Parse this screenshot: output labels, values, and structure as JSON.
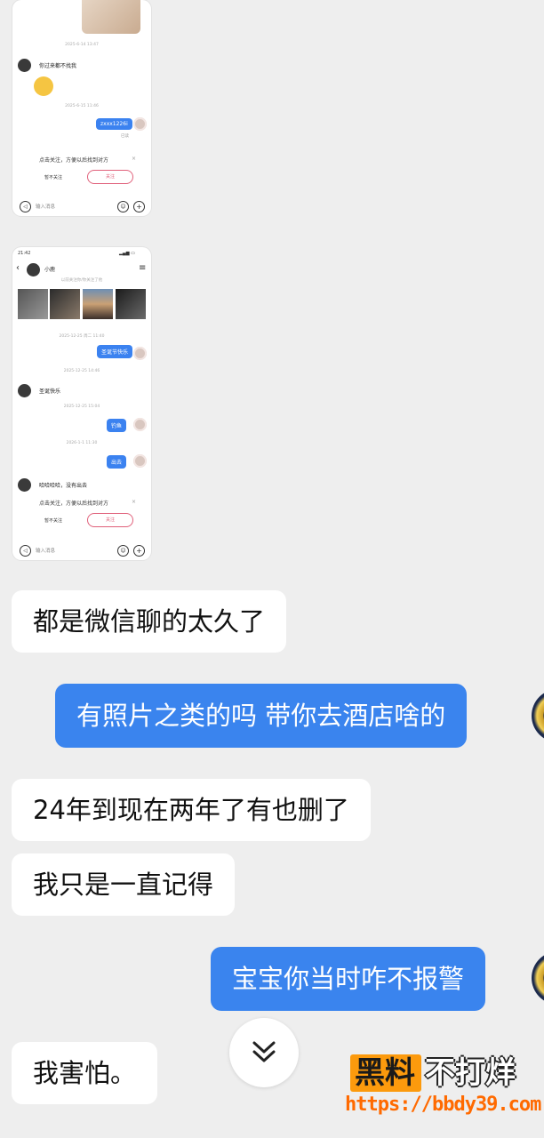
{
  "thumb1": {
    "timestamp_top": "2025-6-14 13:47",
    "msg_in_1": "你过来都不找我",
    "timestamp_2": "2025-6-15 11:46",
    "msg_out_1": "zxxx1226i",
    "read_mark": "已读",
    "follow_prompt": "点击关注，方便以后找到对方",
    "dismiss": "暂不关注",
    "follow_btn": "关注",
    "input_placeholder": "输入消息",
    "close_glyph": "×"
  },
  "thumb2": {
    "status_time": "21:42",
    "contact_name": "小鹿",
    "subtitle": "以前关注你/你关注了他",
    "ts_1": "2025-12-25 周二 11:40",
    "msg_out_1": "圣诞节快乐",
    "ts_2": "2025-12-25 14:46",
    "msg_in_1": "圣诞快乐",
    "ts_3": "2025-12-25 15:04",
    "msg_out_2": "钓鱼",
    "ts_4": "2026-1-1 11:30",
    "msg_out_3": "出去",
    "msg_in_2": "哈哈哈哈，没有出去",
    "follow_prompt": "点击关注，方便以后找到对方",
    "dismiss": "暂不关注",
    "follow_btn": "关注",
    "input_placeholder": "输入消息",
    "close_glyph": "×"
  },
  "messages": [
    {
      "dir": "in",
      "text": "都是微信聊的太久了"
    },
    {
      "dir": "out",
      "text": "有照片之类的吗 带你去酒店啥的"
    },
    {
      "dir": "in",
      "text": "24年到现在两年了有也删了"
    },
    {
      "dir": "in",
      "text": "我只是一直记得"
    },
    {
      "dir": "out",
      "text": "宝宝你当时咋不报警"
    },
    {
      "dir": "in",
      "text": "我害怕。"
    }
  ],
  "watermark": {
    "box_text": "黑料",
    "side_text": "不打烊",
    "url": "https://bbdy39.com"
  },
  "icons": {
    "scroll_down": "chevron-double-down-icon"
  },
  "colors": {
    "outgoing_bubble": "#3a84ee",
    "incoming_bubble": "#ffffff",
    "background": "#eeeeee",
    "watermark_orange": "#fc9a0d",
    "follow_accent": "#e0607a"
  }
}
